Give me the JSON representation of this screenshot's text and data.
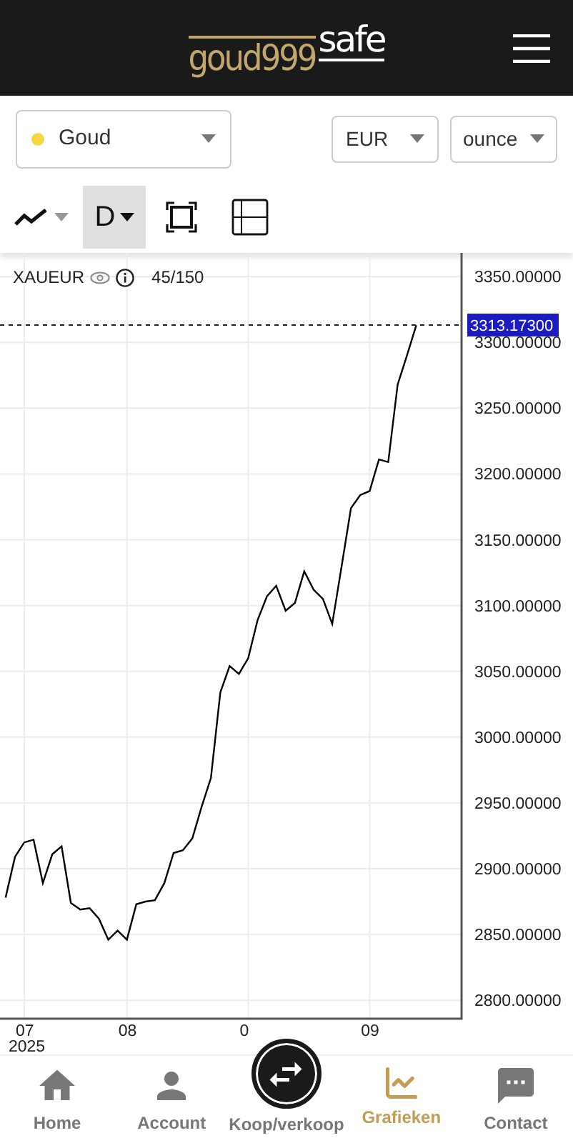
{
  "header": {
    "logo": {
      "part1": "goud999",
      "part2": "safe"
    }
  },
  "selectors": {
    "asset": {
      "label": "Goud",
      "color": "#f5d742"
    },
    "currency": "EUR",
    "unit": "ounce"
  },
  "toolbar": {
    "interval": {
      "label": "D",
      "selected": true
    }
  },
  "chart": {
    "legend": {
      "count": "45/150"
    },
    "year_label": "2025",
    "chart_data": {
      "type": "line",
      "grid": true,
      "categories": [
        null,
        null,
        "07",
        null,
        null,
        null,
        null,
        null,
        null,
        null,
        null,
        null,
        null,
        "08",
        null,
        null,
        null,
        null,
        null,
        null,
        null,
        null,
        null,
        null,
        null,
        null,
        "0",
        null,
        null,
        null,
        null,
        null,
        null,
        null,
        null,
        null,
        null,
        null,
        null,
        "09",
        null,
        null,
        null,
        null,
        null
      ],
      "ylim": [
        2786,
        3368
      ],
      "ref_lines": [
        {
          "axis": "y",
          "value": 3313.173,
          "label": "3313.17300"
        }
      ],
      "yticks": [
        {
          "value": 2800,
          "label": "2800.00000"
        },
        {
          "value": 2850,
          "label": "2850.00000"
        },
        {
          "value": 2900,
          "label": "2900.00000"
        },
        {
          "value": 2950,
          "label": "2950.00000"
        },
        {
          "value": 3000,
          "label": "3000.00000"
        },
        {
          "value": 3050,
          "label": "3050.00000"
        },
        {
          "value": 3100,
          "label": "3100.00000"
        },
        {
          "value": 3150,
          "label": "3150.00000"
        },
        {
          "value": 3200,
          "label": "3200.00000"
        },
        {
          "value": 3250,
          "label": "3250.00000"
        },
        {
          "value": 3300,
          "label": "3300.00000"
        },
        {
          "value": 3350,
          "label": "3350.00000"
        }
      ],
      "series": [
        {
          "name": "XAUEUR",
          "color": "#000000",
          "values": [
            2878,
            2909,
            2920,
            2922,
            2889,
            2911,
            2917,
            2874,
            2869,
            2870,
            2862,
            2846,
            2853,
            2846,
            2873,
            2875,
            2876,
            2889,
            2912,
            2914,
            2923,
            2947,
            2969,
            3034,
            3054,
            3048,
            3060,
            3089,
            3107,
            3115,
            3096,
            3102,
            3126,
            3112,
            3105,
            3086,
            3130,
            3174,
            3184,
            3187,
            3211,
            3209,
            3268,
            3290,
            3313
          ]
        }
      ]
    }
  },
  "nav": [
    {
      "label": "Home",
      "kind": "tab",
      "selected": false
    },
    {
      "label": "Account",
      "kind": "tab",
      "selected": false
    },
    {
      "label": "Koop/verkoop",
      "kind": "action",
      "selected": false
    },
    {
      "label": "Grafieken",
      "kind": "tab",
      "selected": true
    },
    {
      "label": "Contact",
      "kind": "tab",
      "selected": false
    }
  ]
}
